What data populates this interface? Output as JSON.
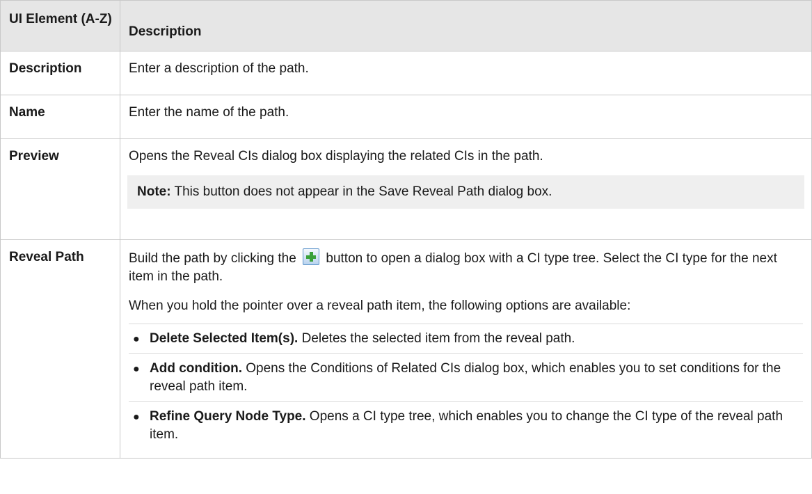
{
  "table": {
    "header": {
      "col1": "UI Element (A-Z)",
      "col2": "Description"
    },
    "rows": [
      {
        "element": "Description",
        "description": "Enter a description of the path."
      },
      {
        "element": "Name",
        "description": "Enter the name of the path."
      },
      {
        "element": "Preview",
        "description": "Opens the Reveal CIs dialog box displaying the related CIs in the path.",
        "note_label": "Note:",
        "note_text": " This button does not appear in the Save Reveal Path dialog box."
      },
      {
        "element": "Reveal Path",
        "desc_before_icon": "Build the path by clicking the ",
        "icon": "add-plus-icon",
        "desc_after_icon": " button to open a dialog box with a CI type tree. Select the CI type for the next item in the path.",
        "paragraph2": "When you hold the pointer over a reveal path item, the following options are available:",
        "options": [
          {
            "title": "Delete Selected Item(s).",
            "text": " Deletes the selected item from the reveal path."
          },
          {
            "title": "Add condition.",
            "text": " Opens the Conditions of Related CIs dialog box, which enables you to set conditions for the reveal path item."
          },
          {
            "title": "Refine Query Node Type.",
            "text": " Opens a CI type tree, which enables you to change the CI type of the reveal path item."
          }
        ]
      }
    ]
  },
  "colors": {
    "header_bg": "#e6e6e6",
    "note_bg": "#efefef",
    "border": "#c8c8c8"
  }
}
